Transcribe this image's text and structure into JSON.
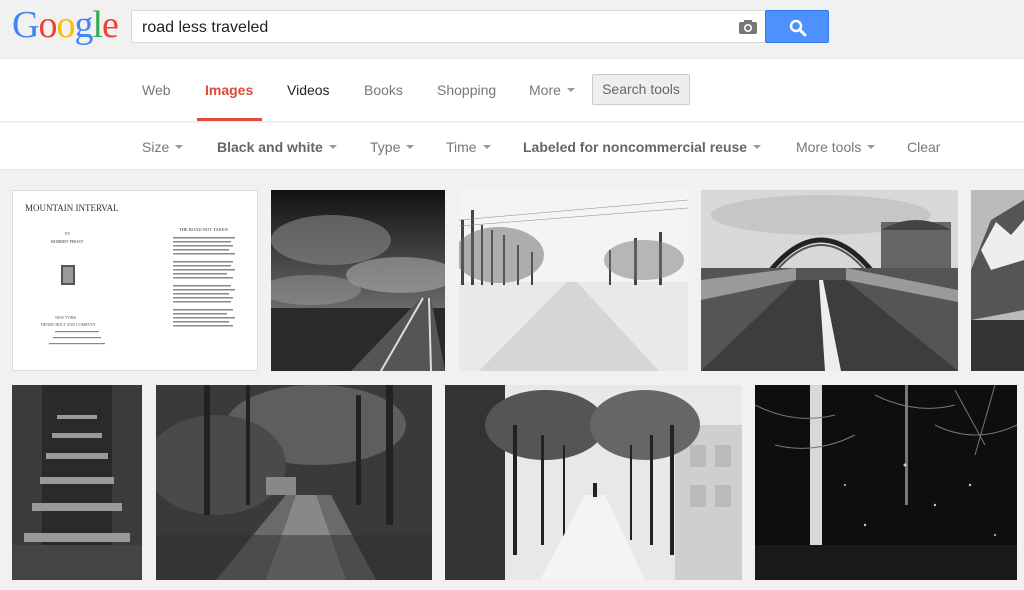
{
  "logo": {
    "letters": [
      "G",
      "o",
      "o",
      "g",
      "l",
      "e"
    ],
    "colors": [
      "#4285f4",
      "#ea4335",
      "#fbbc05",
      "#4285f4",
      "#34a853",
      "#ea4335"
    ]
  },
  "search": {
    "query": "road less traveled"
  },
  "tabs": [
    {
      "label": "Web"
    },
    {
      "label": "Images"
    },
    {
      "label": "Videos"
    },
    {
      "label": "Books"
    },
    {
      "label": "Shopping"
    },
    {
      "label": "More"
    }
  ],
  "search_tools_label": "Search tools",
  "filters": {
    "size": "Size",
    "color": "Black and white",
    "type": "Type",
    "time": "Time",
    "usage": "Labeled for noncommercial reuse",
    "more_tools": "More tools",
    "clear": "Clear"
  },
  "results": {
    "book_page": {
      "title": "MOUNTAIN INTERVAL",
      "by": "BY",
      "author": "ROBERT FROST",
      "poem_title": "THE ROAD NOT TAKEN",
      "place": "NEW YORK",
      "publisher": "HENRY HOLT AND COMPANY"
    },
    "images": [
      "book-page",
      "railway-tracks",
      "snowy-road",
      "highway-arch",
      "mountain",
      "stone-stairs",
      "forest-path",
      "tree-lined-walkway",
      "night-forest"
    ]
  },
  "colors": {
    "accent": "#dd4b39",
    "button": "#4d90fe"
  }
}
